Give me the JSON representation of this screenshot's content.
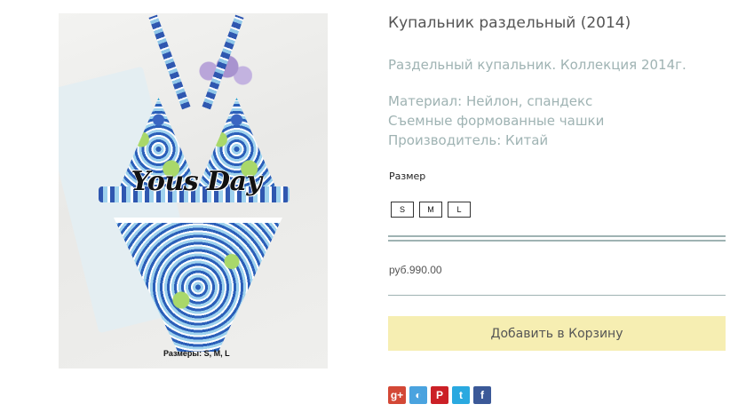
{
  "product": {
    "title": "Купальник раздельный (2014)",
    "description": [
      "Раздельный купальник. Коллекция 2014г."
    ],
    "details": [
      "Материал: Нейлон, спандекс",
      "Съемные формованные чашки",
      "Производитель: Китай"
    ],
    "image": {
      "watermark": "Yous Day",
      "caption": "Размеры: S, M, L"
    }
  },
  "size_selector": {
    "label": "Размер",
    "options": [
      "S",
      "M",
      "L"
    ]
  },
  "price": "руб.990.00",
  "cart": {
    "add_label": "Добавить в Корзину"
  },
  "social": [
    {
      "name": "google-plus",
      "glyph": "g+",
      "color": "#d34836"
    },
    {
      "name": "livejournal",
      "glyph": "◐",
      "color": "#4aa3df"
    },
    {
      "name": "pinterest",
      "glyph": "P",
      "color": "#cb2027"
    },
    {
      "name": "twitter",
      "glyph": "t",
      "color": "#2aa9e0"
    },
    {
      "name": "facebook",
      "glyph": "f",
      "color": "#3b5998"
    }
  ]
}
